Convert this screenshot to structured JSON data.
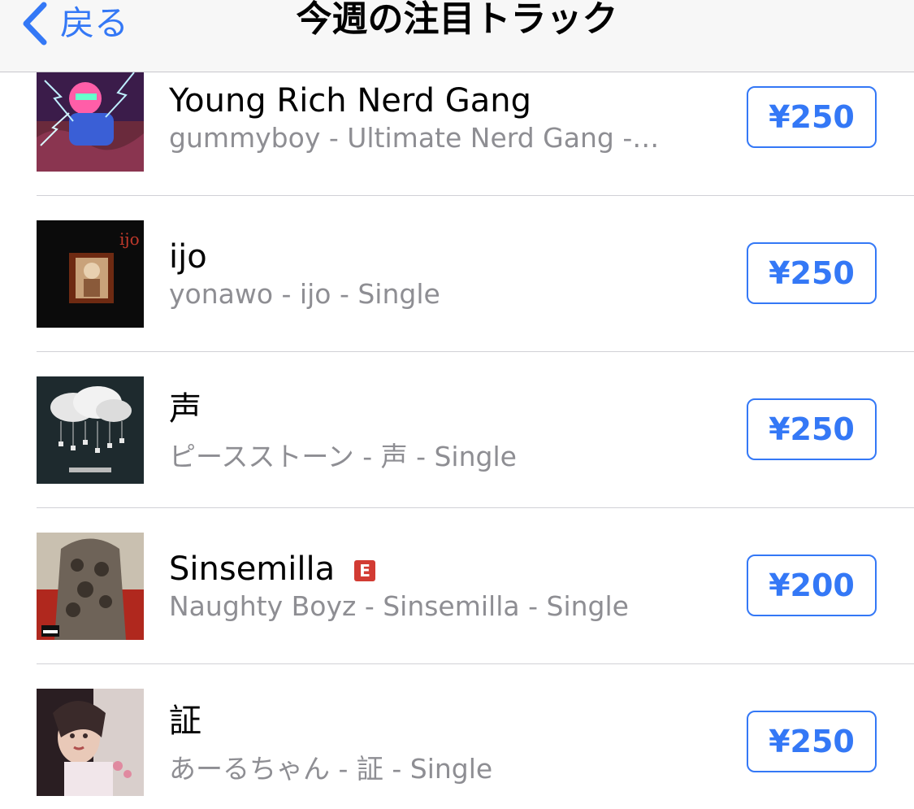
{
  "navbar": {
    "back_label": "戻る",
    "title": "今週の注目トラック"
  },
  "tracks": [
    {
      "title": "Young Rich Nerd Gang",
      "subtitle": "gummyboy - Ultimate Nerd Gang -…",
      "price": "¥250",
      "explicit": false,
      "artwork_icon": "album-artwork"
    },
    {
      "title": "ijo",
      "subtitle": "yonawo - ijo - Single",
      "price": "¥250",
      "explicit": false,
      "artwork_icon": "album-artwork"
    },
    {
      "title": "声",
      "subtitle": "ピースストーン - 声 - Single",
      "price": "¥250",
      "explicit": false,
      "artwork_icon": "album-artwork"
    },
    {
      "title": "Sinsemilla",
      "subtitle": "Naughty Boyz - Sinsemilla - Single",
      "price": "¥200",
      "explicit": true,
      "explicit_label": "E",
      "artwork_icon": "album-artwork"
    },
    {
      "title": "証",
      "subtitle": "あーるちゃん - 証 - Single",
      "price": "¥250",
      "explicit": false,
      "artwork_icon": "album-artwork"
    }
  ],
  "colors": {
    "accent": "#3478f6",
    "explicit": "#d23b33",
    "subtitle": "#8e8e93"
  }
}
